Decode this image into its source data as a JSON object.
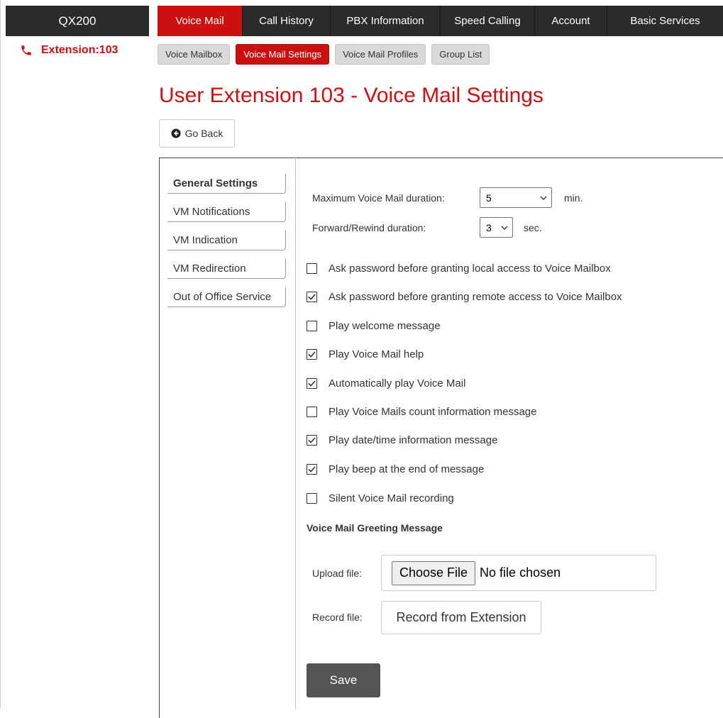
{
  "brand": "QX200",
  "extension_label": "Extension:103",
  "top_nav": [
    {
      "label": "Voice Mail",
      "active": true
    },
    {
      "label": "Call History",
      "active": false
    },
    {
      "label": "PBX Information",
      "active": false
    },
    {
      "label": "Speed Calling",
      "active": false
    },
    {
      "label": "Account",
      "active": false
    },
    {
      "label": "Basic Services",
      "active": false
    }
  ],
  "sub_nav": [
    {
      "label": "Voice Mailbox",
      "active": false
    },
    {
      "label": "Voice Mail Settings",
      "active": true
    },
    {
      "label": "Voice Mail Profiles",
      "active": false
    },
    {
      "label": "Group List",
      "active": false
    }
  ],
  "page_title": "User Extension 103 - Voice Mail Settings",
  "go_back_label": "Go Back",
  "side_tabs": [
    {
      "label": "General Settings",
      "active": true
    },
    {
      "label": "VM Notifications",
      "active": false
    },
    {
      "label": "VM Indication",
      "active": false
    },
    {
      "label": "VM Redirection",
      "active": false
    },
    {
      "label": "Out of Office Service",
      "active": false
    }
  ],
  "max_duration": {
    "label": "Maximum Voice Mail duration:",
    "value": "5",
    "unit": "min."
  },
  "ff_duration": {
    "label": "Forward/Rewind duration:",
    "value": "3",
    "unit": "sec."
  },
  "options": [
    {
      "label": "Ask password before granting local access to Voice Mailbox",
      "checked": false
    },
    {
      "label": "Ask password before granting remote access to Voice Mailbox",
      "checked": true
    },
    {
      "label": "Play welcome message",
      "checked": false
    },
    {
      "label": "Play Voice Mail help",
      "checked": true
    },
    {
      "label": "Automatically play Voice Mail",
      "checked": true
    },
    {
      "label": "Play Voice Mails count information message",
      "checked": false
    },
    {
      "label": "Play date/time information message",
      "checked": true
    },
    {
      "label": "Play beep at the end of message",
      "checked": true
    },
    {
      "label": "Silent Voice Mail recording",
      "checked": false
    }
  ],
  "greeting": {
    "title": "Voice Mail Greeting Message",
    "upload_label": "Upload file:",
    "choose_file_label": "Choose File",
    "no_file_text": "No file chosen",
    "record_label": "Record file:",
    "record_button": "Record from Extension"
  },
  "save_label": "Save",
  "colors": {
    "accent": "#cc1010",
    "dark": "#2b2b2b"
  }
}
